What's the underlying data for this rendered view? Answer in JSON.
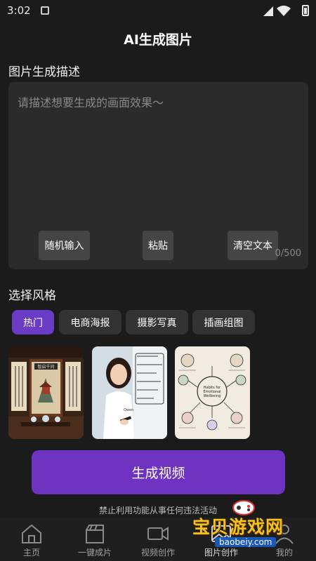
{
  "status_bar": {
    "time": "3:02",
    "icons": [
      "notification-icon",
      "signal-icon",
      "wifi-icon",
      "battery-icon"
    ]
  },
  "header": {
    "title": "AI生成图片"
  },
  "prompt": {
    "section_label": "图片生成描述",
    "placeholder": "请描述想要生成的画面效果～",
    "value": "",
    "buttons": {
      "random": "随机输入",
      "paste": "粘贴",
      "clear": "清空文本"
    },
    "char_count": "0/500"
  },
  "style": {
    "section_label": "选择风格",
    "tabs": [
      {
        "label": "热门",
        "active": true
      },
      {
        "label": "电商海报",
        "active": false
      },
      {
        "label": "摄影写真",
        "active": false
      },
      {
        "label": "插画组图",
        "active": false
      }
    ],
    "samples": [
      {
        "name": "chinese-interior-painting-sample",
        "text": "智启千问"
      },
      {
        "name": "woman-whiteboard-photo-sample",
        "text": "Qwen"
      },
      {
        "name": "mind-map-illustration-sample",
        "text": "Habits for Emotional Wellbeing"
      }
    ]
  },
  "generate_button": {
    "label": "生成视频"
  },
  "disclaimer": "禁止利用功能从事任何违法活动",
  "tab_bar": {
    "items": [
      {
        "label": "主页",
        "icon": "home-icon",
        "active": false
      },
      {
        "label": "一键成片",
        "icon": "clapperboard-icon",
        "active": false
      },
      {
        "label": "视频创作",
        "icon": "video-camera-icon",
        "active": false
      },
      {
        "label": "图片创作",
        "icon": "image-icon",
        "active": true
      },
      {
        "label": "我的",
        "icon": "profile-icon",
        "active": false
      }
    ]
  },
  "watermark": {
    "text": "宝贝游戏网",
    "url": "baobeiy.com"
  },
  "colors": {
    "background": "#1b1b1b",
    "accent": "#6f33c2",
    "active_tab": "#6a3bc4",
    "panel": "#2b2b2b"
  }
}
